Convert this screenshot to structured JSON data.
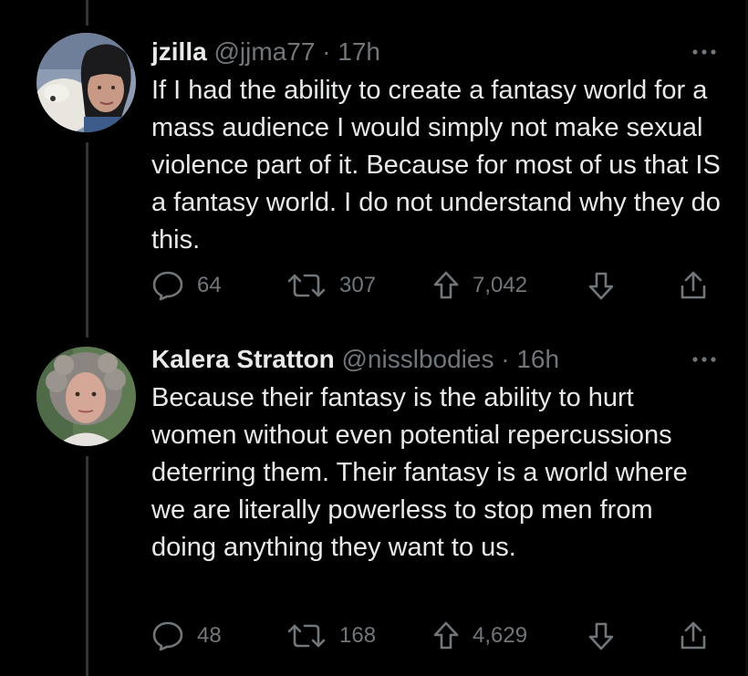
{
  "theme": {
    "background": "#000000",
    "text": "#e7e9ea",
    "muted": "#71767b",
    "thread_line": "#333639"
  },
  "tweets": [
    {
      "display_name": "jzilla",
      "handle": "@jjma77",
      "separator": " · ",
      "time": "17h",
      "avatar_icon": "avatar-woman-with-dog",
      "text": "If I had the ability to create a fantasy world for a mass audience I would simply not make sexual violence part of it. Because for most of us that IS a fantasy world. I do not understand why they do this.",
      "replies": "64",
      "retweets": "307",
      "upvotes": "7,042"
    },
    {
      "display_name": "Kalera Stratton",
      "handle": "@nisslbodies",
      "separator": " · ",
      "time": "16h",
      "avatar_icon": "avatar-woman-curly-hair",
      "text": "Because their fantasy is the ability to hurt women without even potential repercussions deterring them. Their fantasy is a world where we are literally powerless to stop men from doing anything they want to us.",
      "replies": "48",
      "retweets": "168",
      "upvotes": "4,629"
    }
  ]
}
